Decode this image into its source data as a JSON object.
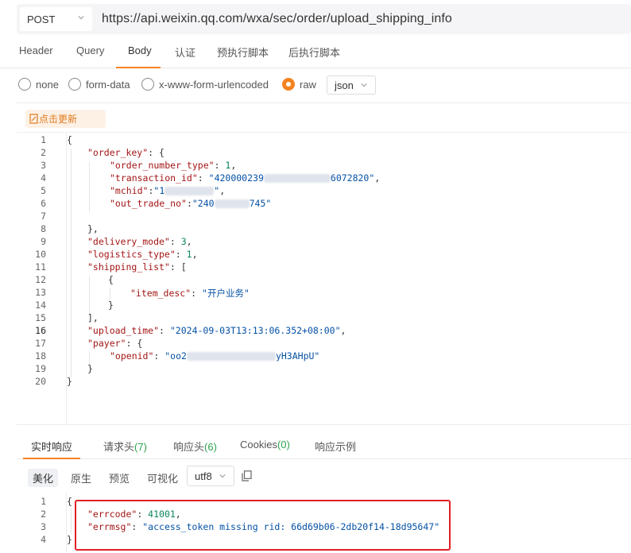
{
  "request": {
    "method": "POST",
    "url": "https://api.weixin.qq.com/wxa/sec/order/upload_shipping_info"
  },
  "req_tabs": [
    "Header",
    "Query",
    "Body",
    "认证",
    "预执行脚本",
    "后执行脚本"
  ],
  "body_types": [
    "none",
    "form-data",
    "x-www-form-urlencoded",
    "raw"
  ],
  "body_format": "json",
  "update_label": "点击更新",
  "line_numbers": [
    "1",
    "2",
    "3",
    "4",
    "5",
    "6",
    "7",
    "8",
    "9",
    "10",
    "11",
    "12",
    "13",
    "14",
    "15",
    "16",
    "17",
    "18",
    "19",
    "20"
  ],
  "code": {
    "l1": "{",
    "l2_key": "\"order_key\"",
    "l3_key": "\"order_number_type\"",
    "l3_val": "1",
    "l4_key": "\"transaction_id\"",
    "l4_val_a": "\"420000239",
    "l4_val_b": "6072820\"",
    "l5_key": "\"mchid\"",
    "l5_val_a": "\"1",
    "l5_val_b": "\"",
    "l6_key": "\"out_trade_no\"",
    "l6_val_a": "\"240",
    "l6_val_b": "745\"",
    "l10_key": "\"delivery_mode\"",
    "l10_val": "3",
    "l11_key": "\"logistics_type\"",
    "l11_val": "1",
    "l12_key": "\"shipping_list\"",
    "l14_key": "\"item_desc\"",
    "l14_val": "\"开户业务\"",
    "l16_key": "\"upload_time\"",
    "l16_val": "\"2024-09-03T13:13:06.352+08:00\"",
    "l17_key": "\"payer\"",
    "l18_key": "\"openid\"",
    "l18_val_a": "\"oo2",
    "l18_val_b": "yH3AHpU\""
  },
  "resp_tabs": {
    "t1": "实时响应",
    "t2": "请求头",
    "t2_count": "(7)",
    "t3": "响应头",
    "t3_count": "(6)",
    "t4": "Cookies",
    "t4_count": "(0)",
    "t5": "响应示例"
  },
  "resp_sub": [
    "美化",
    "原生",
    "预览",
    "可视化"
  ],
  "resp_encoding": "utf8",
  "resp_line_numbers": [
    "1",
    "2",
    "3",
    "4"
  ],
  "response": {
    "l1": "{",
    "errcode_key": "\"errcode\"",
    "errcode_val": "41001",
    "errmsg_key": "\"errmsg\"",
    "errmsg_val": "\"access_token missing rid: 66d69b06-2db20f14-18d95647\"",
    "l4": "}"
  },
  "colors": {
    "accent": "#f5831f",
    "highlight_box": "#e31e24",
    "count_green": "#2da44e"
  }
}
